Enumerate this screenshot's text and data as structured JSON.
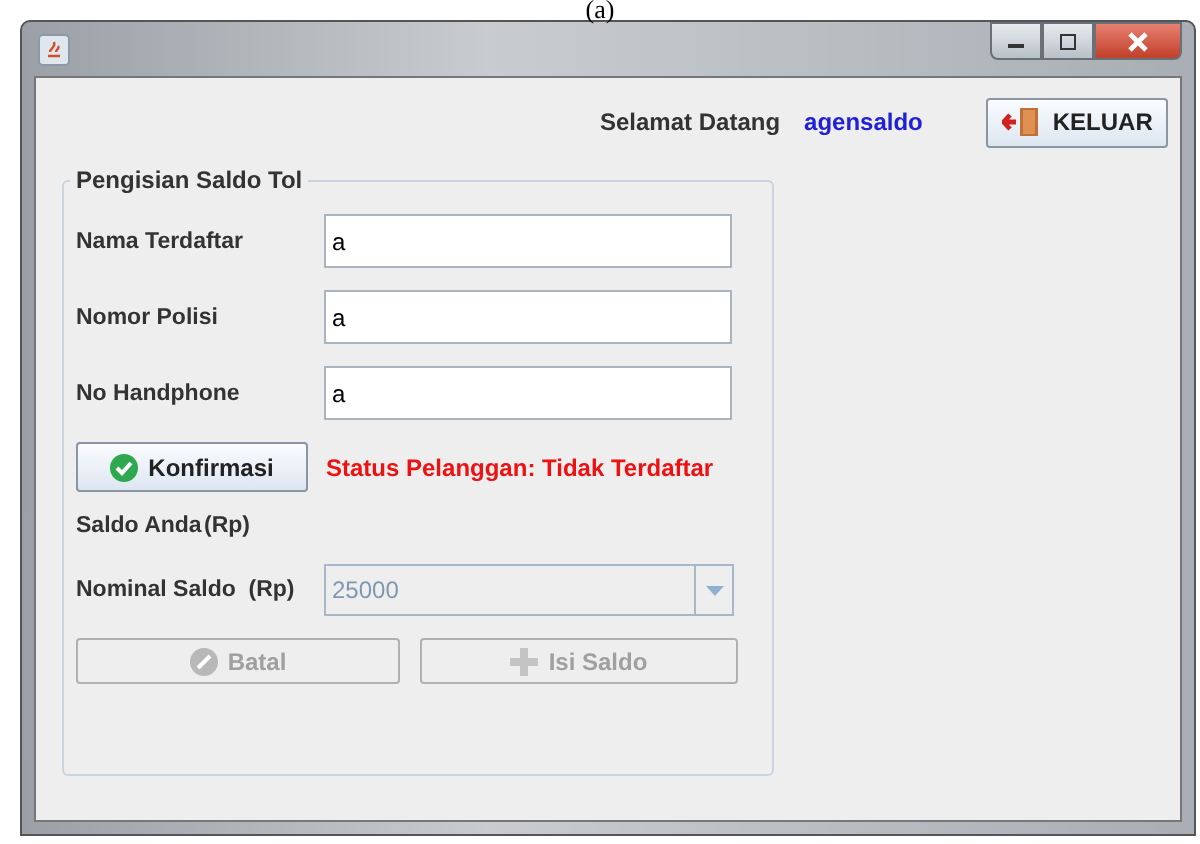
{
  "caption": "(a)",
  "window": {
    "controls": [
      {
        "kind": "minimize"
      },
      {
        "kind": "maximize"
      },
      {
        "kind": "close"
      }
    ]
  },
  "header": {
    "greeting": "Selamat Datang",
    "user": "agensaldo",
    "logout_button": "KELUAR"
  },
  "form": {
    "title": "Pengisian Saldo Tol",
    "fields": [
      {
        "label": "Nama Terdaftar",
        "value": "a"
      },
      {
        "label": "Nomor Polisi",
        "value": "a"
      },
      {
        "label": "No Handphone",
        "value": "a"
      }
    ],
    "confirm_button": "Konfirmasi",
    "status": "Status Pelanggan: Tidak Terdaftar",
    "balance": {
      "label": "Saldo Anda",
      "unit": "(Rp)"
    },
    "amount": {
      "label": "Nominal Saldo  (Rp)",
      "value": "25000",
      "disabled": true
    },
    "buttons": [
      {
        "kind": "cancel",
        "label": "Batal",
        "disabled": true
      },
      {
        "kind": "add",
        "label": "Isi Saldo",
        "disabled": true
      }
    ]
  }
}
